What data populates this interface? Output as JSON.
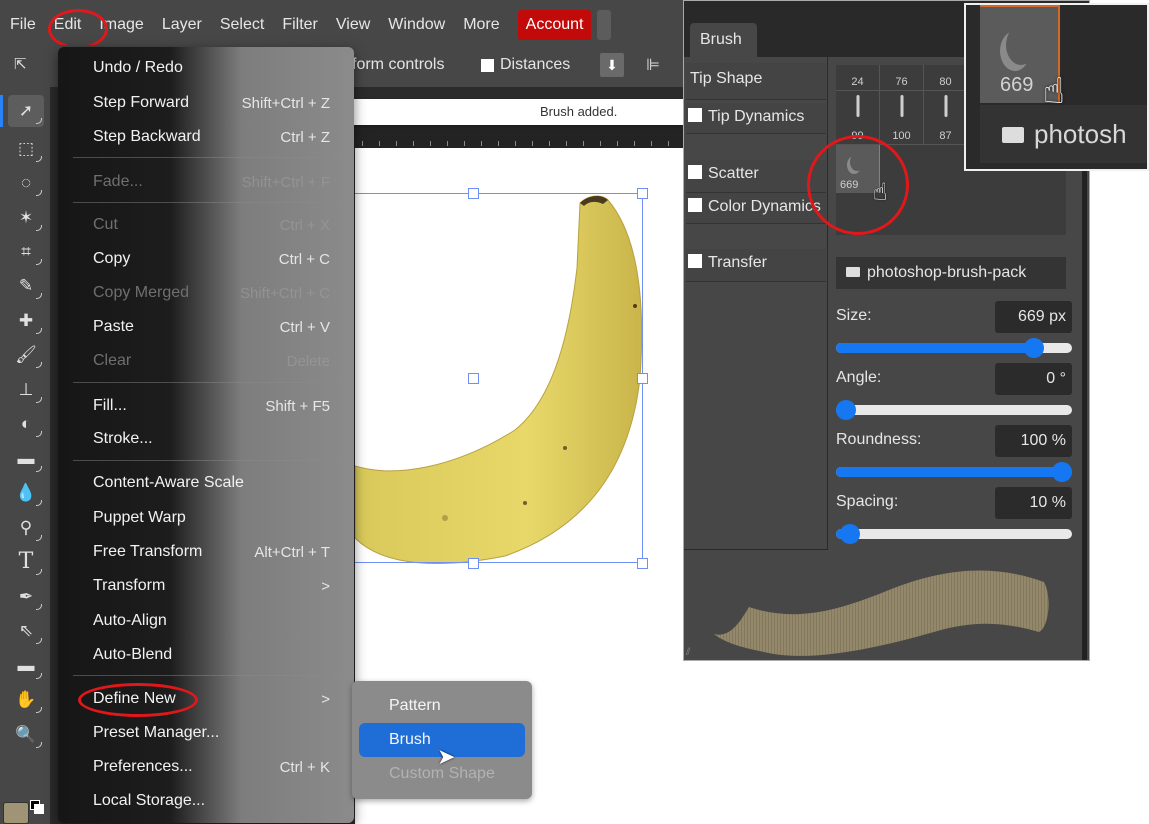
{
  "menubar": {
    "items": [
      "File",
      "Edit",
      "Image",
      "Layer",
      "Select",
      "Filter",
      "View",
      "Window",
      "More"
    ],
    "account": "Account"
  },
  "options_bar": {
    "transform_controls": "form controls",
    "distances": "Distances"
  },
  "toast": "Brush added.",
  "toolbar": {
    "tools": [
      "move",
      "select-move",
      "marquee",
      "lasso",
      "magic-wand",
      "crop",
      "eyedropper",
      "healing",
      "brush",
      "stamp",
      "eraser",
      "gradient",
      "blur",
      "dodge",
      "type",
      "pen",
      "path-select",
      "shape",
      "hand",
      "zoom"
    ],
    "foreground_color": "#a09477"
  },
  "edit_menu": {
    "items": [
      {
        "label": "Undo / Redo",
        "shortcut": ""
      },
      {
        "label": "Step Forward",
        "shortcut": "Shift+Ctrl + Z"
      },
      {
        "label": "Step Backward",
        "shortcut": "Ctrl + Z"
      },
      {
        "label": "Fade...",
        "shortcut": "Shift+Ctrl + F",
        "disabled": true
      },
      {
        "label": "Cut",
        "shortcut": "Ctrl + X",
        "disabled": true
      },
      {
        "label": "Copy",
        "shortcut": "Ctrl + C"
      },
      {
        "label": "Copy Merged",
        "shortcut": "Shift+Ctrl + C",
        "disabled": true
      },
      {
        "label": "Paste",
        "shortcut": "Ctrl + V"
      },
      {
        "label": "Clear",
        "shortcut": "Delete",
        "disabled": true
      },
      {
        "label": "Fill...",
        "shortcut": "Shift + F5"
      },
      {
        "label": "Stroke...",
        "shortcut": ""
      },
      {
        "label": "Content-Aware Scale",
        "shortcut": ""
      },
      {
        "label": "Puppet Warp",
        "shortcut": ""
      },
      {
        "label": "Free Transform",
        "shortcut": "Alt+Ctrl + T"
      },
      {
        "label": "Transform",
        "shortcut": ">"
      },
      {
        "label": "Auto-Align",
        "shortcut": ""
      },
      {
        "label": "Auto-Blend",
        "shortcut": ""
      },
      {
        "label": "Define New",
        "shortcut": ">"
      },
      {
        "label": "Preset Manager...",
        "shortcut": ""
      },
      {
        "label": "Preferences...",
        "shortcut": "Ctrl + K"
      },
      {
        "label": "Local Storage...",
        "shortcut": ""
      }
    ]
  },
  "submenu": {
    "items": [
      {
        "label": "Pattern"
      },
      {
        "label": "Brush",
        "highlighted": true
      },
      {
        "label": "Custom Shape",
        "disabled": true
      }
    ]
  },
  "brush_panel": {
    "tab": "Brush",
    "sections": [
      "Tip Shape",
      "Tip Dynamics",
      "Scatter",
      "Color Dynamics",
      "Transfer"
    ],
    "tip_sizes_row1": [
      "24",
      "76",
      "80"
    ],
    "tip_sizes_row2": [
      "99",
      "100",
      "87"
    ],
    "selected_tip": "669",
    "folder": "photoshop-brush-pack",
    "size": {
      "label": "Size:",
      "value": "669  px",
      "fraction": 0.84
    },
    "angle": {
      "label": "Angle:",
      "value": "0 °",
      "fraction": 0.0
    },
    "roundness": {
      "label": "Roundness:",
      "value": "100 %",
      "fraction": 1.0
    },
    "spacing": {
      "label": "Spacing:",
      "value": "10 %",
      "fraction": 0.06
    }
  },
  "inset": {
    "tip": "669",
    "folder": "photosh"
  }
}
